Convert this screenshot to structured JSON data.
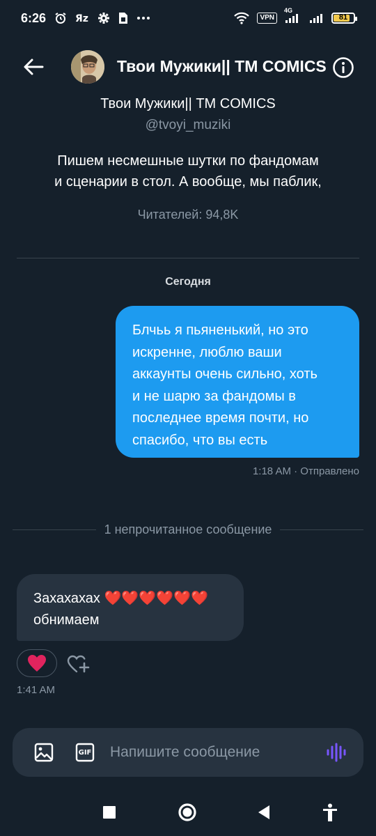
{
  "status_bar": {
    "time": "6:26",
    "vpn_label": "VPN",
    "network_label": "4G",
    "battery_level": "81",
    "battery_fraction": 0.81
  },
  "header": {
    "title": "Твои Мужики|| TM COMICS",
    "back_icon": "arrow-left-icon",
    "info_icon": "info-icon"
  },
  "profile": {
    "name": "Твои Мужики|| TM COMICS",
    "handle": "@tvoyi_muziki",
    "bio_line1": "Пишем несмешные шутки по фандомам",
    "bio_line2": "и сценарии в стол. А вообще, мы паблик,",
    "followers": "Читателей: 94,8K"
  },
  "conversation": {
    "day_label": "Сегодня",
    "sent_message": {
      "lines": [
        "Блчьь я пьяненький, но это",
        "искренне, люблю ваши",
        "аккаунты очень сильно, хоть",
        "и не шарю за фандомы в",
        "последнее время почти, но",
        "спасибо, что вы есть"
      ],
      "meta": "1:18 AM · Отправлено"
    },
    "unread_label": "1 непрочитанное сообщение",
    "received_message": {
      "line1_text": "Захахахах",
      "line1_hearts": "❤️❤️❤️❤️❤️❤️",
      "line2": "обнимаем",
      "reaction": "❤️",
      "time": "1:41 AM"
    }
  },
  "composer": {
    "placeholder": "Напишите сообщение",
    "gif_label": "GIF"
  },
  "colors": {
    "background": "#15202b",
    "sent_bubble": "#1d9bf0",
    "received_bubble": "#273340",
    "secondary_text": "#8b98a5",
    "voice_accent": "#7856ff"
  }
}
